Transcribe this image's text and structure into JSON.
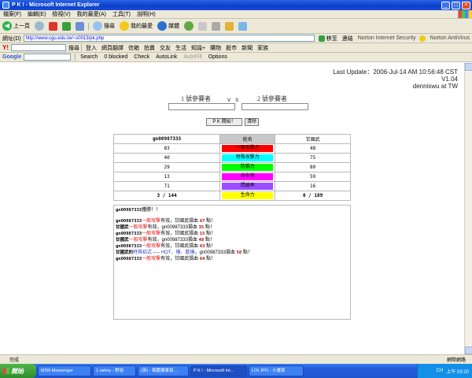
{
  "window": {
    "title": "P K ! - Microsoft Internet Explorer",
    "min": "_",
    "max": "□",
    "close": "×"
  },
  "menu": [
    "檔案(F)",
    "編輯(E)",
    "檢視(V)",
    "我的最愛(A)",
    "工具(T)",
    "說明(H)"
  ],
  "toolbar": {
    "back": "上一頁",
    "search": "搜尋",
    "favorites": "我的最愛",
    "media": "媒體"
  },
  "address": {
    "label": "網址(D)",
    "url": "http://www.cgu.edu.tw/~s0013/pk.php",
    "go": "移至",
    "links": "連結",
    "norton_security": "Norton Internet Security",
    "norton_antivirus": "Norton AntiVirus"
  },
  "yahoo_bar": {
    "logo": "Y!",
    "search": "搜尋",
    "items": [
      "登入",
      "網頁翻譯",
      "信箱",
      "拍賣",
      "交友",
      "生活",
      "知識+",
      "購物",
      "股市",
      "新聞",
      "家族"
    ]
  },
  "google_bar": {
    "logo": "Google",
    "items": [
      "Search",
      "0 blocked",
      "Check",
      "AutoLink",
      "AutoFill",
      "Options"
    ]
  },
  "page": {
    "last_update": "Last Update：2006-Jul-14   AM 10:56:48 CST",
    "version": "V1.04",
    "author": "denniswu at TW",
    "player1_label": "1 號參賽者",
    "player2_label": "2 號參賽者",
    "vs": "v s",
    "pk_button": "P K 開始！",
    "clear_button": "清除"
  },
  "stats": {
    "left_name": "gn00987333",
    "header_mid": "姓名",
    "right_name": "甘國武",
    "rows": [
      {
        "left": "83",
        "label": "一般攻擊力",
        "color": "#ff0000",
        "right": "48"
      },
      {
        "left": "40",
        "label": "特殊攻擊力",
        "color": "#00ffff",
        "right": "75"
      },
      {
        "left": "29",
        "label": "防禦力",
        "color": "#00ff00",
        "right": "80"
      },
      {
        "left": "13",
        "label": "命中率",
        "color": "#ff00ff",
        "right": "59"
      },
      {
        "left": "71",
        "label": "閃避率",
        "color": "#9b4dff",
        "right": "16"
      },
      {
        "left": "3  /  144",
        "label": "生命力",
        "color": "#ffff00",
        "right": "0  /  189"
      }
    ]
  },
  "log": {
    "winner_name": "gn00987333",
    "winner_text": "獲勝！！",
    "lines": [
      {
        "atk": "gn00987333",
        "skill": "一般攻擊",
        "mid": "有效，甘國武損血 ",
        "dmg": "67",
        "end": " 點！"
      },
      {
        "atk": "甘國武",
        "skill": "一般攻擊",
        "mid": "有效，gn00987333損血 ",
        "dmg": "35",
        "end": " 點！"
      },
      {
        "atk": "gn00987333",
        "skill": "一般攻擊",
        "mid": "有效，甘國武損血 ",
        "dmg": "15",
        "end": " 點！"
      },
      {
        "atk": "甘國武",
        "skill": "一般攻擊",
        "mid": "有效，gn00987333損血 ",
        "dmg": "48",
        "end": " 點！"
      },
      {
        "atk": "gn00987333",
        "skill": "一般攻擊",
        "mid": "有效，甘國武損血 ",
        "dmg": "63",
        "end": " 點！"
      },
      {
        "atk": "甘國武的",
        "skill": "特殊招式 ── HOT、爆、藍爆",
        "mid": "，gn00987333損血 ",
        "dmg": "58",
        "end": " 點！"
      },
      {
        "atk": "gn00987333",
        "skill": "一般攻擊",
        "mid": "有效，甘國武損血 ",
        "dmg": "64",
        "end": " 點！"
      }
    ]
  },
  "status": {
    "text": "完成",
    "zone": "網際網路"
  },
  "taskbar": {
    "start": "開始",
    "tasks": [
      "MSN Messenger",
      "1 oshey - 對話",
      "(英) - 楊慶廣東寫...",
      "P K ! - Microsoft Int...",
      "LOL IPO - 小畫家"
    ],
    "tray_lang": "CH",
    "clock": "上午 03:20"
  }
}
